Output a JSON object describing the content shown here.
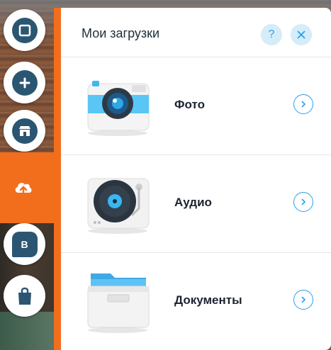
{
  "panel": {
    "title": "Мои загрузки",
    "help_icon": "question-icon",
    "close_icon": "close-icon"
  },
  "rail": {
    "items": [
      {
        "icon": "square-icon"
      },
      {
        "icon": "plus-icon"
      },
      {
        "icon": "store-icon"
      },
      {
        "icon": "upload-cloud-icon",
        "active": true
      },
      {
        "icon": "blog-icon",
        "letter": "B"
      },
      {
        "icon": "shopping-bag-icon"
      }
    ]
  },
  "uploads": [
    {
      "label": "Фото",
      "icon": "camera-icon"
    },
    {
      "label": "Аудио",
      "icon": "turntable-icon"
    },
    {
      "label": "Документы",
      "icon": "document-box-icon"
    }
  ],
  "colors": {
    "accent": "#f26e1d",
    "rail_icon": "#2b5672",
    "link": "#2aa0ea"
  }
}
